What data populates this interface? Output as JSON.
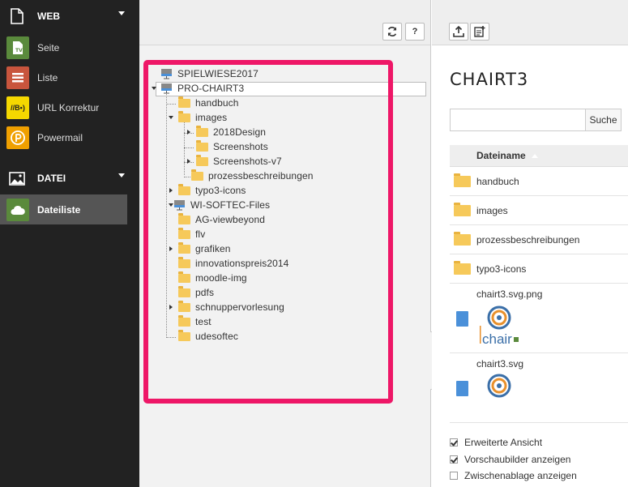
{
  "sidebar": {
    "groups": [
      {
        "label": "WEB",
        "icon": "page-icon"
      },
      {
        "label": "DATEI",
        "icon": "image-icon"
      }
    ],
    "modules": [
      {
        "label": "Seite",
        "icon": "page-module-icon",
        "color": "#5a8a3c"
      },
      {
        "label": "Liste",
        "icon": "list-module-icon",
        "color": "#c8553d"
      },
      {
        "label": "URL Korrektur",
        "icon": "url-module-icon",
        "color": "#f5d800",
        "icon_text": "//B•)"
      },
      {
        "label": "Powermail",
        "icon": "powermail-icon",
        "color": "#f0a000"
      },
      {
        "label": "Dateiliste",
        "icon": "filelist-module-icon",
        "color": "#5a8a3c"
      }
    ]
  },
  "tree_toolbar": {
    "refresh_icon": "refresh-icon",
    "help_label": "?"
  },
  "tree": {
    "nodes": [
      "SPIELWIESE2017",
      "PRO-CHAIRT3",
      "handbuch",
      "images",
      "2018Design",
      "Screenshots",
      "Screenshots-v7",
      "prozessbeschreibungen",
      "typo3-icons",
      "WI-SOFTEC-Files",
      "AG-viewbeyond",
      "flv",
      "grafiken",
      "innovationspreis2014",
      "moodle-img",
      "pdfs",
      "schnuppervorlesung",
      "test",
      "udesoftec"
    ]
  },
  "content": {
    "title": "CHAIRT3",
    "search_placeholder": "",
    "search_button": "Suche",
    "column_header": "Dateiname",
    "folders": [
      "handbuch",
      "images",
      "prozessbeschreibungen",
      "typo3-icons"
    ],
    "files": [
      {
        "name": "chairt3.svg.png",
        "thumb_text": "chair"
      },
      {
        "name": "chairt3.svg"
      }
    ],
    "options": [
      {
        "label": "Erweiterte Ansicht",
        "checked": true
      },
      {
        "label": "Vorschaubilder anzeigen",
        "checked": true
      },
      {
        "label": "Zwischenablage anzeigen",
        "checked": false
      }
    ]
  },
  "colors": {
    "highlight": "#ee1767",
    "folder": "#f6c95a",
    "sidebar_bg": "#222222"
  }
}
